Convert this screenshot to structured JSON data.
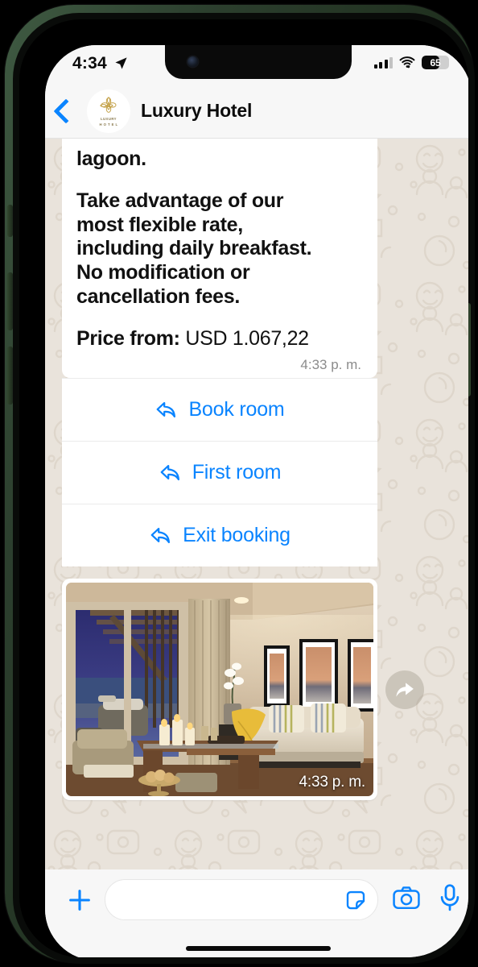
{
  "status_bar": {
    "time": "4:34",
    "location_icon": "location-arrow-icon",
    "signal_icon": "cellular-signal-icon",
    "wifi_icon": "wifi-icon",
    "battery_level": "65",
    "battery_percent": 65
  },
  "header": {
    "back_icon": "back-chevron-icon",
    "avatar_icon": "hotel-flower-logo",
    "avatar_brand_line1": "LUXURY",
    "avatar_brand_line2": "H O T E L",
    "title": "Luxury Hotel"
  },
  "message": {
    "lines": [
      "lagoon.",
      "Take advantage of our",
      "most flexible rate,",
      "including daily breakfast.",
      "No modification or",
      "cancellation fees."
    ],
    "price_label": "Price from:",
    "price_value": "USD 1.067,22",
    "timestamp": "4:33 p. m."
  },
  "actions": [
    {
      "label": "Book room",
      "icon": "reply-arrow-icon"
    },
    {
      "label": "First room",
      "icon": "reply-arrow-icon"
    },
    {
      "label": "Exit booking",
      "icon": "reply-arrow-icon"
    }
  ],
  "image_message": {
    "alt": "luxury hotel suite living room with sofa, coffee table, candles and terrace view at dusk",
    "timestamp": "4:33 p. m.",
    "forward_icon": "forward-arrow-icon"
  },
  "composer": {
    "plus_icon": "plus-icon",
    "input_value": "",
    "input_placeholder": "",
    "sticker_icon": "sticker-icon",
    "camera_icon": "camera-icon",
    "mic_icon": "microphone-icon"
  },
  "colors": {
    "accent_blue": "#0a84ff",
    "chat_background": "#e9e3db",
    "bubble_white": "#ffffff",
    "bar_gray": "#f7f7f7",
    "logo_gold": "#c4a24a"
  }
}
